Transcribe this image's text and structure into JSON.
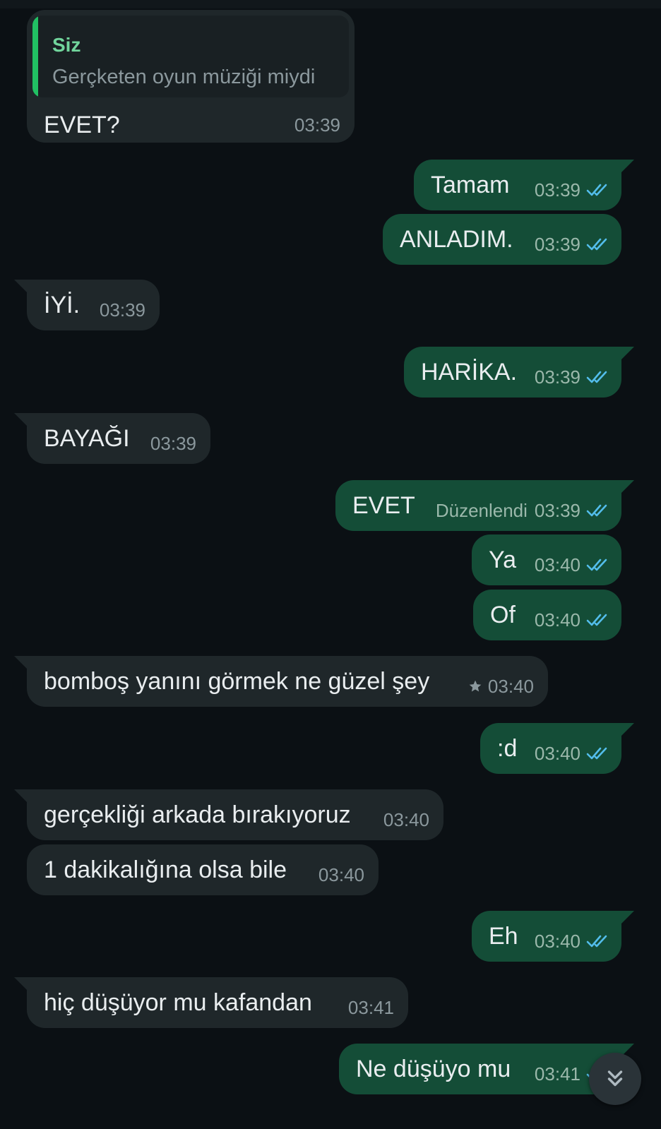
{
  "quote": {
    "author": "Siz",
    "text": "Gerçketen oyun müziği miydi"
  },
  "messages": [
    {
      "id": "m1",
      "direction": "in",
      "text": "EVET?",
      "time": "03:39"
    },
    {
      "id": "m2",
      "direction": "out",
      "text": "Tamam",
      "time": "03:39",
      "status": "read"
    },
    {
      "id": "m3",
      "direction": "out",
      "text": "ANLADIM.",
      "time": "03:39",
      "status": "read"
    },
    {
      "id": "m4",
      "direction": "in",
      "text": "İYİ.",
      "time": "03:39"
    },
    {
      "id": "m5",
      "direction": "out",
      "text": "HARİKA.",
      "time": "03:39",
      "status": "read"
    },
    {
      "id": "m6",
      "direction": "in",
      "text": "BAYAĞI",
      "time": "03:39"
    },
    {
      "id": "m7",
      "direction": "out",
      "text": "EVET",
      "edited": "Düzenlendi",
      "time": "03:39",
      "status": "read"
    },
    {
      "id": "m8",
      "direction": "out",
      "text": "Ya",
      "time": "03:40",
      "status": "read"
    },
    {
      "id": "m9",
      "direction": "out",
      "text": "Of",
      "time": "03:40",
      "status": "read"
    },
    {
      "id": "m10",
      "direction": "in",
      "text": "bomboş yanını görmek ne güzel şey",
      "time": "03:40",
      "starred": true
    },
    {
      "id": "m11",
      "direction": "out",
      "text": ":d",
      "time": "03:40",
      "status": "read"
    },
    {
      "id": "m12",
      "direction": "in",
      "text": "gerçekliği arkada bırakıyoruz",
      "time": "03:40"
    },
    {
      "id": "m13",
      "direction": "in",
      "text": "1 dakikalığına olsa bile",
      "time": "03:40"
    },
    {
      "id": "m14",
      "direction": "out",
      "text": "Eh",
      "time": "03:40",
      "status": "read"
    },
    {
      "id": "m15",
      "direction": "in",
      "text": "hiç düşüyor mu kafandan",
      "time": "03:41"
    },
    {
      "id": "m16",
      "direction": "out",
      "text": "Ne düşüyo mu",
      "time": "03:41",
      "status": "read"
    }
  ],
  "icons": {
    "read_ticks": "double-check-icon",
    "star": "star-icon",
    "scroll_down": "double-chevron-down-icon"
  },
  "colors": {
    "incoming": "#1f272a",
    "outgoing": "#144d37",
    "read_tick": "#53bdeb",
    "quote_bar": "#21c063"
  }
}
